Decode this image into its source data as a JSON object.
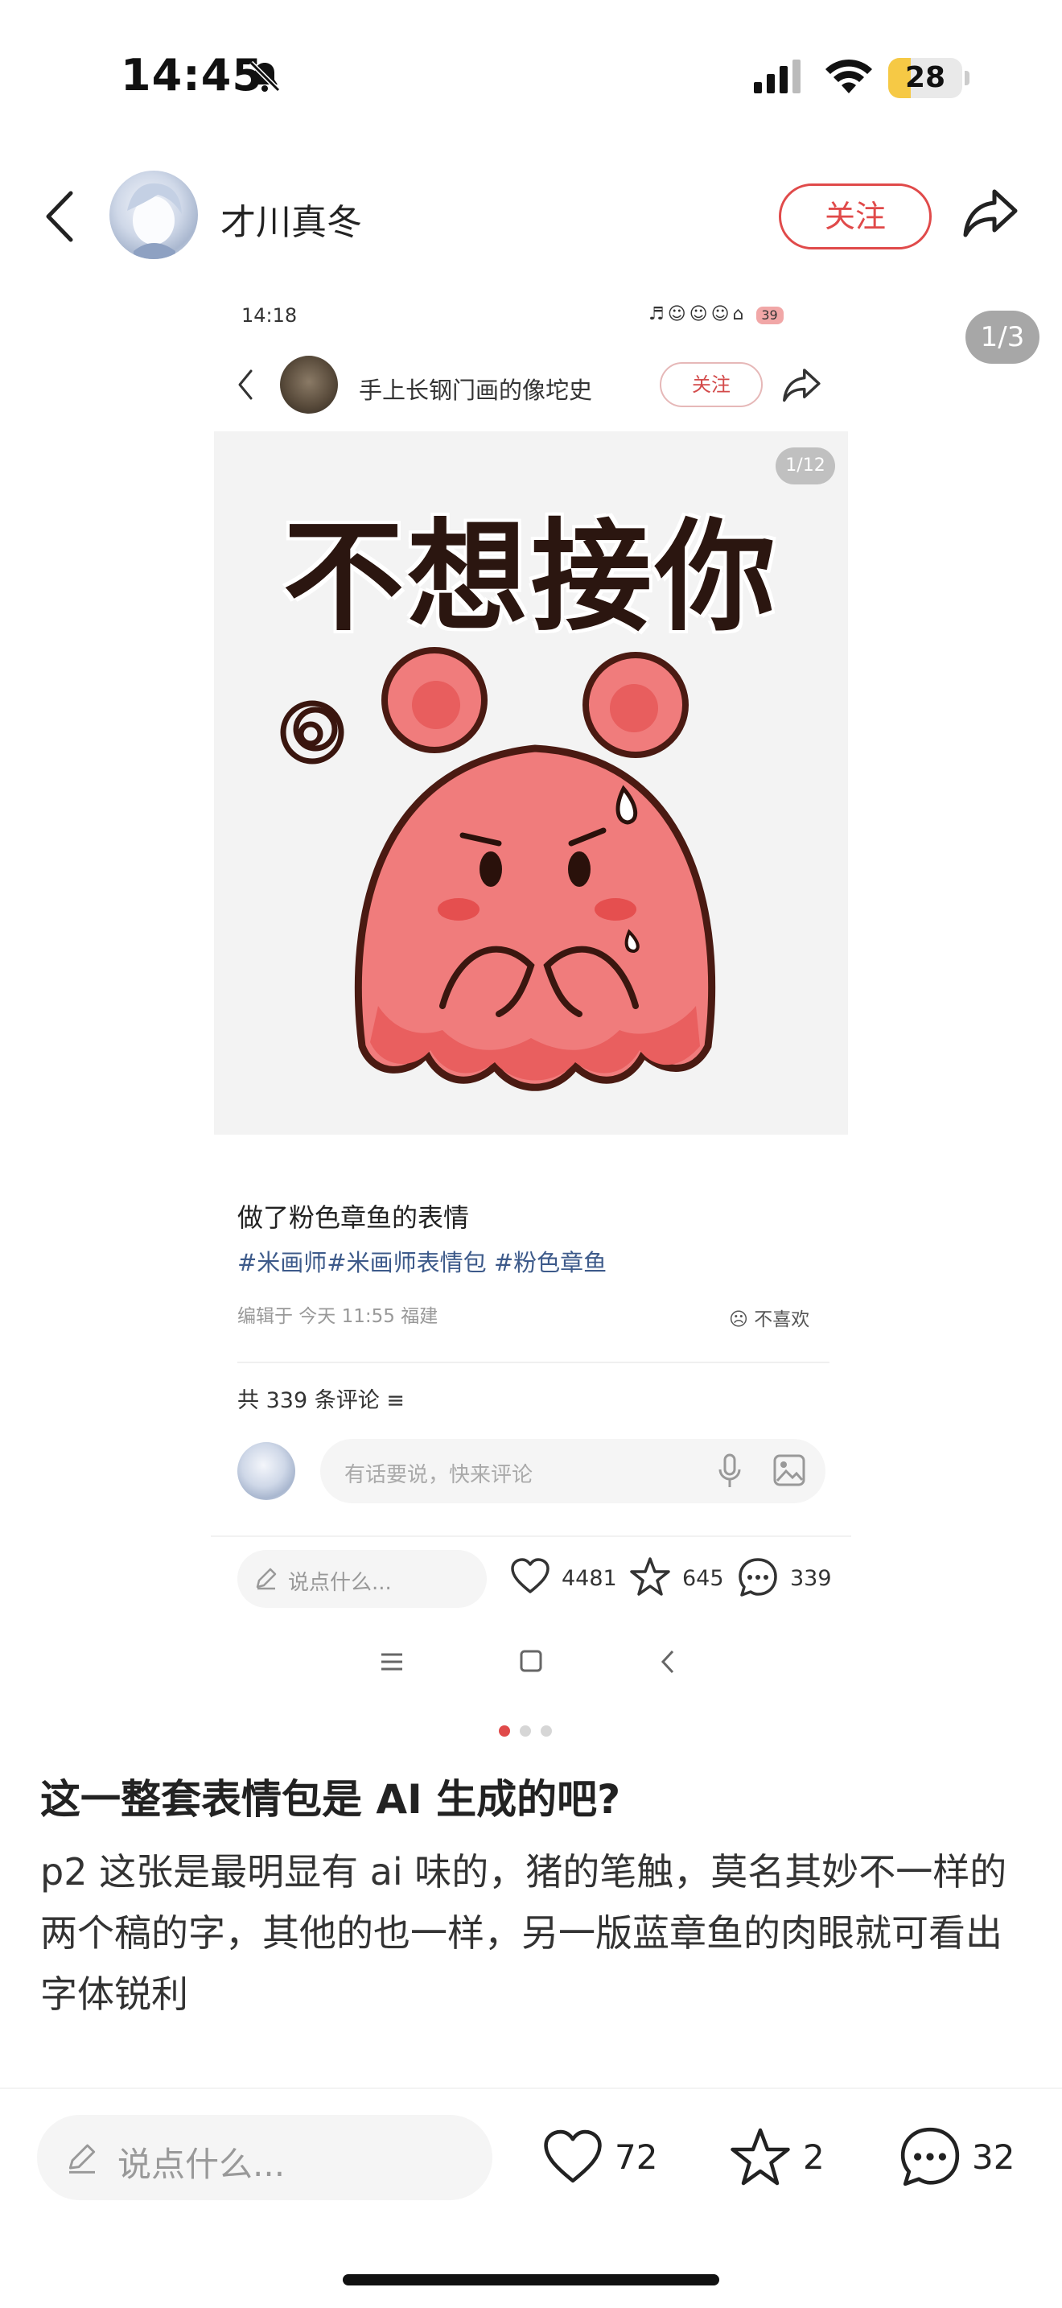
{
  "status_bar": {
    "time": "14:45",
    "battery": "28",
    "icons": [
      "bell-slash-icon",
      "signal-icon",
      "wifi-icon",
      "battery-icon"
    ]
  },
  "header": {
    "username": "才川真冬",
    "follow_label": "关注"
  },
  "image_counter": "1/3",
  "embedded_screenshot": {
    "time": "14:18",
    "status_icons": "♬☺☺☺⌂",
    "battery": "39",
    "username": "手上长钢门画的像坨史",
    "follow_label": "关注",
    "image_counter": "1/12",
    "sticker_text": "不想接你",
    "post_title": "做了粉色章鱼的表情",
    "tags": "#米画师#米画师表情包 #粉色章鱼",
    "edit_info": "编辑于 今天 11:55 福建",
    "dislike_label": "不喜欢",
    "comments_count": "共 339 条评论",
    "comment_placeholder": "有话要说，快来评论",
    "say_placeholder": "说点什么...",
    "likes": "4481",
    "stars": "645",
    "comments": "339"
  },
  "carousel": {
    "total": 3,
    "active": 0
  },
  "post": {
    "title": "这一整套表情包是 AI 生成的吧?",
    "body": "p2 这张是最明显有 ai 味的，猪的笔触，莫名其妙不一样的两个稿的字，其他的也一样，另一版蓝章鱼的肉眼就可看出字体锐利"
  },
  "bottom_bar": {
    "say_placeholder": "说点什么...",
    "likes": "72",
    "stars": "2",
    "comments": "32"
  },
  "colors": {
    "accent": "#e04a4a",
    "tag_blue": "#3d5a8a",
    "octopus_pink": "#f07c7c"
  }
}
